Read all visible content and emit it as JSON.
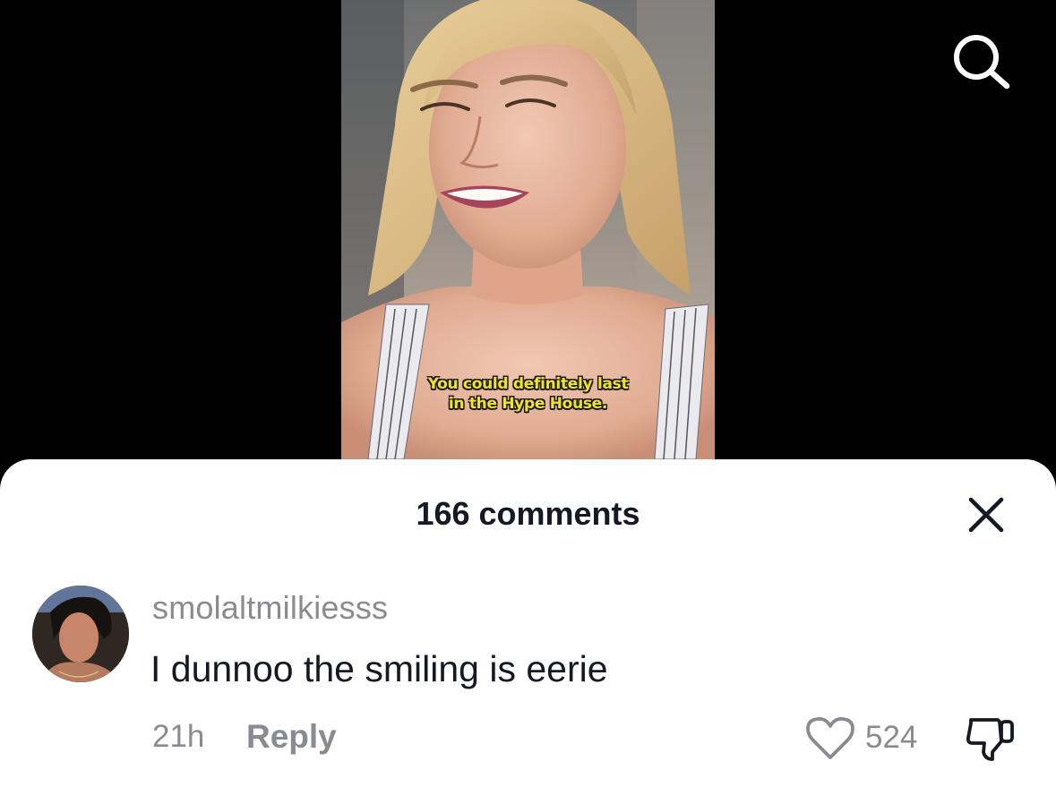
{
  "video": {
    "caption_line1": "You could definitely last",
    "caption_line2": "in the Hype House."
  },
  "header": {
    "search_icon": "search-icon"
  },
  "comments_sheet": {
    "title": "166 comments",
    "close_icon": "close-icon"
  },
  "comment": {
    "username": "smolaltmilkiesss",
    "text": "I dunnoo the smiling is eerie",
    "time": "21h",
    "reply_label": "Reply",
    "like_count": "524",
    "like_icon": "heart-outline-icon",
    "dislike_icon": "thumbs-down-icon"
  },
  "colors": {
    "background": "#000000",
    "sheet": "#ffffff",
    "primary_text": "#161823",
    "secondary_text": "#8a8b91",
    "caption": "#f1e22a"
  }
}
